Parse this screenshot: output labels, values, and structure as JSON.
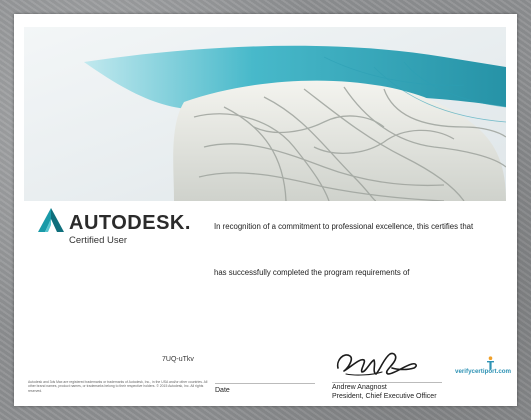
{
  "logo": {
    "wordmark": "AUTODESK.",
    "subtitle": "Certified User"
  },
  "statement": {
    "line1": "In recognition of a commitment to professional excellence, this certifies that",
    "line2": "has successfully completed the program requirements of"
  },
  "certificate_id": "7UQ-uTkv",
  "legal_notice": "Autodesk and 3ds Max are registered trademarks or trademarks of Autodesk, Inc., in the USA and/or other countries. All other brand names, product names, or trademarks belong to their respective holders. © 2015 Autodesk, Inc. All rights reserved.",
  "date_label": "Date",
  "signer": {
    "name": "Andrew Anagnost",
    "title": "President, Chief Executive Officer"
  },
  "verify": {
    "link": "verifycertiport.com"
  },
  "colors": {
    "banner_teal": "#3fb6c8",
    "logo_teal": "#1a9aa8",
    "verify_blue": "#2f93b5"
  }
}
